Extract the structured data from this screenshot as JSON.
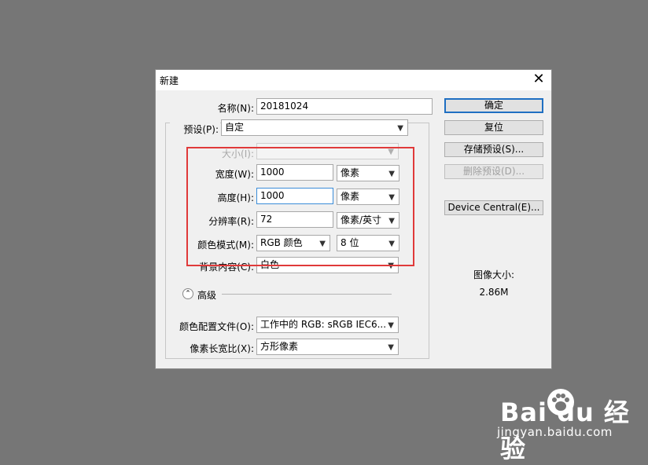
{
  "dialog": {
    "title": "新建",
    "close_glyph": "✕",
    "name_label": "名称(N):",
    "name_value": "20181024",
    "preset_label": "预设(P):",
    "preset_value": "自定",
    "size_label": "大小(I):",
    "size_value": "",
    "width_label": "宽度(W):",
    "width_value": "1000",
    "width_unit": "像素",
    "height_label": "高度(H):",
    "height_value": "1000",
    "height_unit": "像素",
    "resolution_label": "分辨率(R):",
    "resolution_value": "72",
    "resolution_unit": "像素/英寸",
    "color_mode_label": "颜色模式(M):",
    "color_mode_value": "RGB 颜色",
    "bit_depth_value": "8 位",
    "background_label": "背景内容(C):",
    "background_value": "白色",
    "advanced_label": "高级",
    "advanced_glyph": "⌃",
    "color_profile_label": "颜色配置文件(O):",
    "color_profile_value": "工作中的 RGB: sRGB IEC6...",
    "pixel_aspect_label": "像素长宽比(X):",
    "pixel_aspect_value": "方形像素",
    "chevron_glyph": "▼"
  },
  "buttons": {
    "ok": "确定",
    "reset": "复位",
    "save_preset": "存储预设(S)...",
    "delete_preset": "删除预设(D)...",
    "device_central": "Device Central(E)..."
  },
  "image_size": {
    "label": "图像大小:",
    "value": "2.86M"
  },
  "watermark": {
    "logo": "Bai du 经验",
    "url": "jingyan.baidu.com"
  },
  "colors": {
    "highlight_box": "#e03a3a",
    "default_button_border": "#1f6fc2",
    "background": "#767676"
  }
}
